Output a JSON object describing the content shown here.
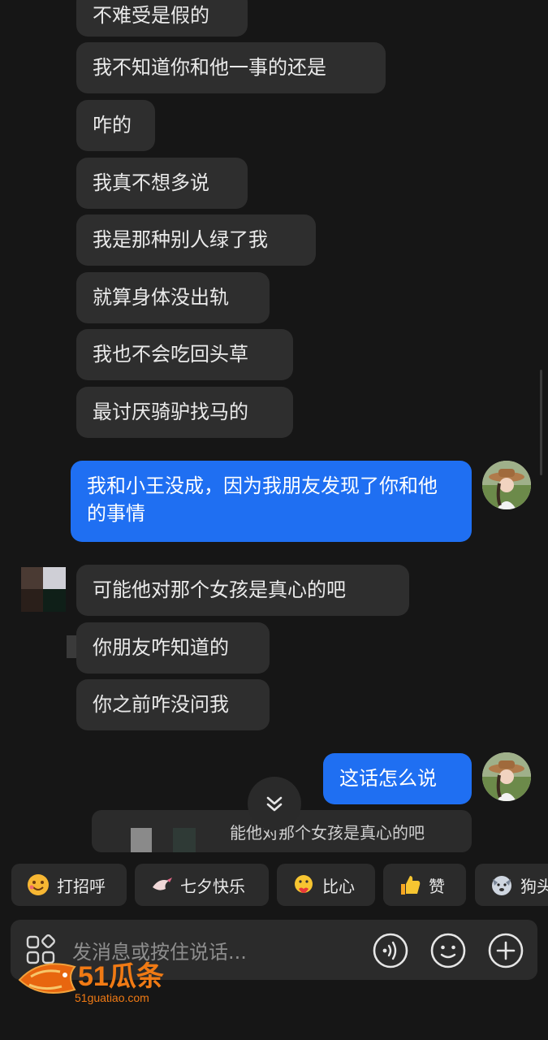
{
  "messages_received_top": [
    "不难受是假的",
    "我不知道你和他一事的还是",
    "咋的",
    "我真不想多说",
    "我是那种别人绿了我",
    "就算身体没出轨",
    "我也不会吃回头草",
    "最讨厌骑驴找马的"
  ],
  "message_sent_1": "我和小王没成，因为我朋友发现了你和他的事情",
  "messages_received_bottom": [
    "可能他对那个女孩是真心的吧",
    "你朋友咋知道的",
    "你之前咋没问我"
  ],
  "message_sent_2": "这话怎么说",
  "quote_preview_text": "能他对那个女孩是真心的吧",
  "quick_replies": [
    {
      "label": "打招呼",
      "icon": "smile-face-icon"
    },
    {
      "label": "七夕快乐",
      "icon": "dove-icon"
    },
    {
      "label": "比心",
      "icon": "duck-heart-icon"
    },
    {
      "label": "赞",
      "icon": "thumbs-up-icon"
    },
    {
      "label": "狗头",
      "icon": "dog-head-icon"
    }
  ],
  "input": {
    "placeholder": "发消息或按住说话..."
  },
  "watermark": {
    "brand": "51瓜条",
    "url": "51guatiao.com"
  },
  "colors": {
    "sent_bubble": "#1f6ff2",
    "received_bubble": "#2e2e2e",
    "background": "#161616"
  }
}
